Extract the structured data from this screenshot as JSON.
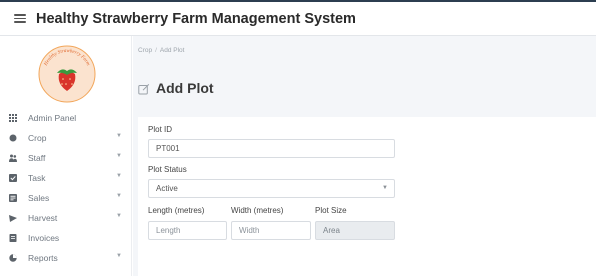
{
  "header": {
    "title": "Healthy Strawberry Farm Management System"
  },
  "logo": {
    "text": "Healthy Strawberry Farm"
  },
  "sidebar": {
    "items": [
      {
        "label": "Admin Panel",
        "icon": "grid-icon",
        "has_submenu": false
      },
      {
        "label": "Crop",
        "icon": "plant-icon",
        "has_submenu": true
      },
      {
        "label": "Staff",
        "icon": "users-icon",
        "has_submenu": true
      },
      {
        "label": "Task",
        "icon": "task-icon",
        "has_submenu": true
      },
      {
        "label": "Sales",
        "icon": "sales-icon",
        "has_submenu": true
      },
      {
        "label": "Harvest",
        "icon": "harvest-icon",
        "has_submenu": true
      },
      {
        "label": "Invoices",
        "icon": "invoice-icon",
        "has_submenu": false
      },
      {
        "label": "Reports",
        "icon": "reports-icon",
        "has_submenu": true
      }
    ]
  },
  "breadcrumb": {
    "parent": "Crop",
    "current": "Add Plot"
  },
  "page": {
    "title": "Add Plot"
  },
  "form": {
    "plot_id": {
      "label": "Plot ID",
      "value": "PT001"
    },
    "plot_status": {
      "label": "Plot Status",
      "value": "Active"
    },
    "length": {
      "label": "Length (metres)",
      "placeholder": "Length"
    },
    "width": {
      "label": "Width (metres)",
      "placeholder": "Width"
    },
    "size": {
      "label": "Plot Size",
      "placeholder": "Area"
    }
  },
  "colors": {
    "brand_dark": "#2c3e50",
    "strawberry": "#d9342b",
    "logo_ring": "#f2a65a",
    "content_bg": "#f4f6f9"
  }
}
